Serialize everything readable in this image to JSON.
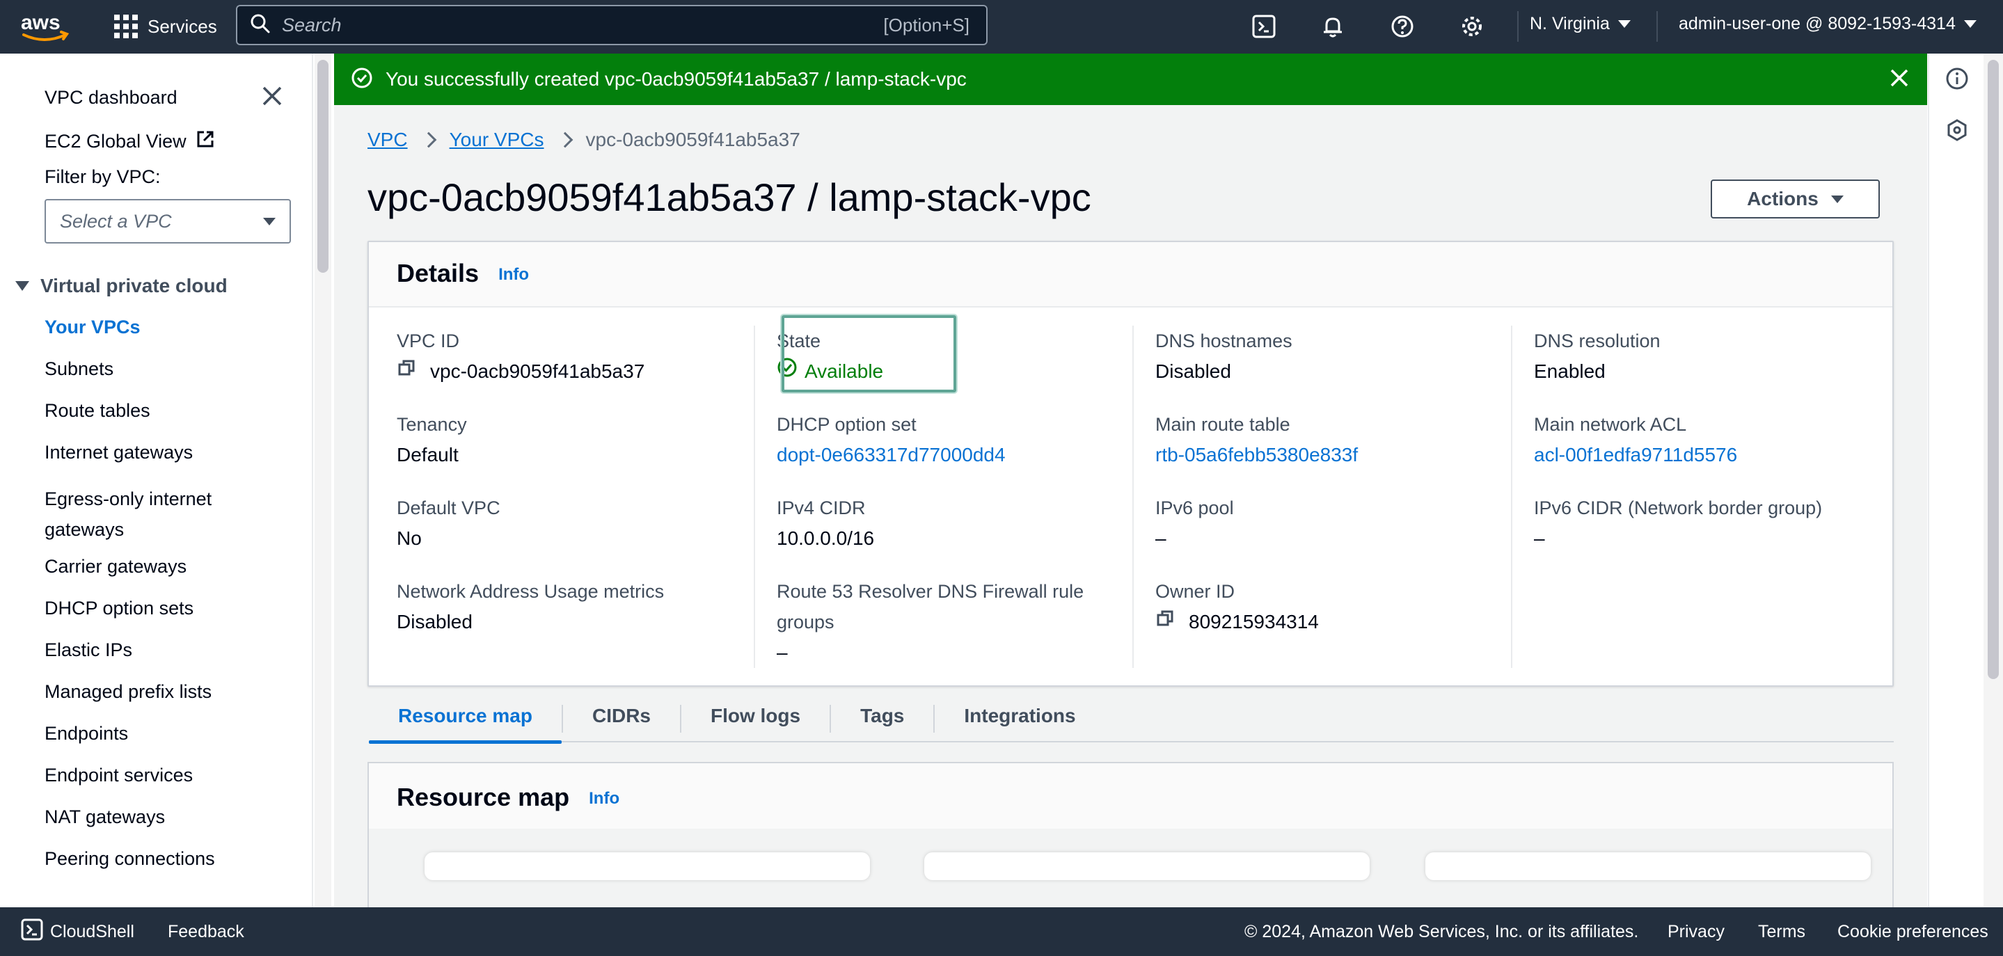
{
  "topnav": {
    "services_label": "Services",
    "search_placeholder": "Search",
    "search_shortcut": "[Option+S]",
    "region_label": "N. Virginia",
    "account_label": "admin-user-one @ 8092-1593-4314"
  },
  "sidebar": {
    "links": [
      "VPC dashboard",
      "EC2 Global View"
    ],
    "filter_label": "Filter by VPC:",
    "select_placeholder": "Select a VPC",
    "section_title": "Virtual private cloud",
    "items": [
      "Your VPCs",
      "Subnets",
      "Route tables",
      "Internet gateways",
      "Egress-only internet gateways",
      "Carrier gateways",
      "DHCP option sets",
      "Elastic IPs",
      "Managed prefix lists",
      "Endpoints",
      "Endpoint services",
      "NAT gateways",
      "Peering connections"
    ],
    "active_item": "Your VPCs"
  },
  "flash": {
    "message": "You successfully created vpc-0acb9059f41ab5a37 / lamp-stack-vpc"
  },
  "breadcrumb": {
    "items": [
      "VPC",
      "Your VPCs",
      "vpc-0acb9059f41ab5a37"
    ]
  },
  "page": {
    "title": "vpc-0acb9059f41ab5a37 / lamp-stack-vpc",
    "actions_label": "Actions"
  },
  "details": {
    "title": "Details",
    "info": "Info",
    "fields": {
      "vpc_id": {
        "label": "VPC ID",
        "value": "vpc-0acb9059f41ab5a37"
      },
      "state": {
        "label": "State",
        "value": "Available"
      },
      "dns_hostnames": {
        "label": "DNS hostnames",
        "value": "Disabled"
      },
      "dns_resolution": {
        "label": "DNS resolution",
        "value": "Enabled"
      },
      "tenancy": {
        "label": "Tenancy",
        "value": "Default"
      },
      "dhcp_option_set": {
        "label": "DHCP option set",
        "value": "dopt-0e663317d77000dd4"
      },
      "main_route_table": {
        "label": "Main route table",
        "value": "rtb-05a6febb5380e833f"
      },
      "main_network_acl": {
        "label": "Main network ACL",
        "value": "acl-00f1edfa9711d5576"
      },
      "default_vpc": {
        "label": "Default VPC",
        "value": "No"
      },
      "ipv4_cidr": {
        "label": "IPv4 CIDR",
        "value": "10.0.0.0/16"
      },
      "ipv6_pool": {
        "label": "IPv6 pool",
        "value": "–"
      },
      "ipv6_cidr": {
        "label": "IPv6 CIDR (Network border group)",
        "value": "–"
      },
      "nau_metrics": {
        "label": "Network Address Usage metrics",
        "value": "Disabled"
      },
      "route53_firewall": {
        "label_line1": "Route 53 Resolver DNS Firewall rule",
        "label_line2": "groups",
        "value": "–"
      },
      "owner_id": {
        "label": "Owner ID",
        "value": "809215934314"
      }
    }
  },
  "tabs": [
    "Resource map",
    "CIDRs",
    "Flow logs",
    "Tags",
    "Integrations"
  ],
  "resource_map": {
    "title": "Resource map",
    "info": "Info"
  },
  "footer": {
    "cloudshell": "CloudShell",
    "feedback": "Feedback",
    "copyright": "© 2024, Amazon Web Services, Inc. or its affiliates.",
    "privacy": "Privacy",
    "terms": "Terms",
    "cookies": "Cookie preferences"
  },
  "colors": {
    "nav_bg": "#232f3e",
    "link": "#0972d3",
    "success": "#037f0c",
    "highlight": "#5fa595"
  }
}
